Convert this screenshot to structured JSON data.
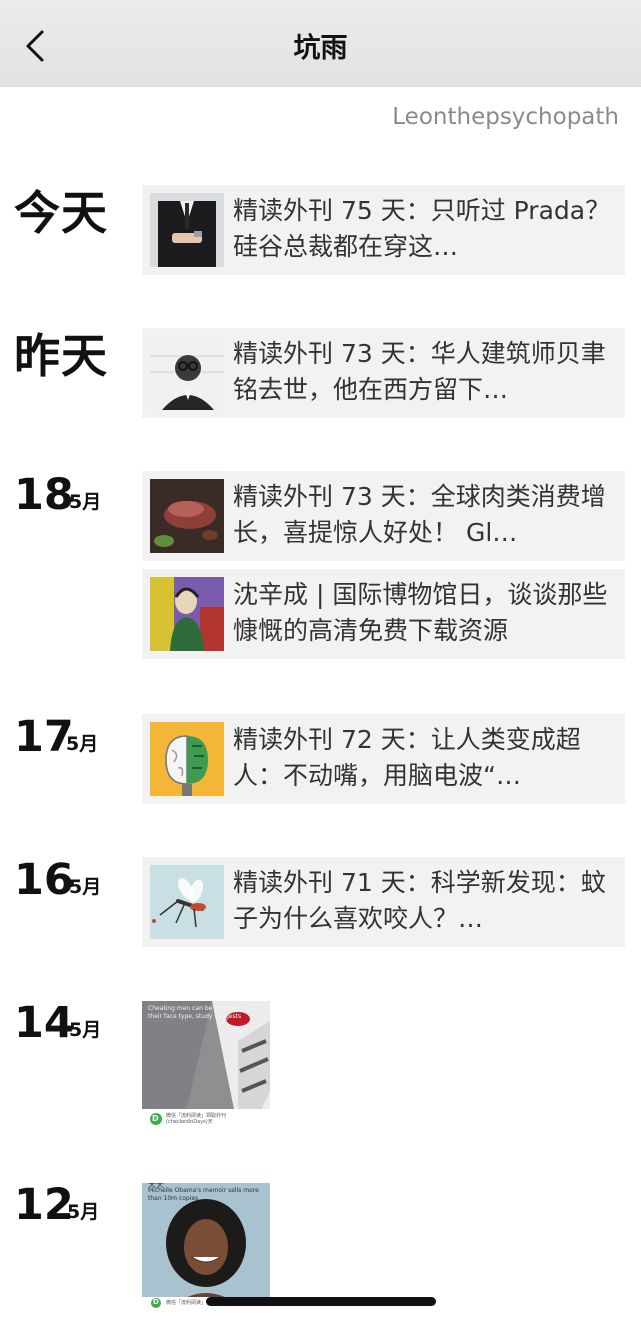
{
  "header": {
    "title": "坑雨",
    "username": "Leonthepsychopath"
  },
  "groups": [
    {
      "day_label": "今天"
    },
    {
      "day_label": "昨天"
    },
    {
      "day": "18",
      "month": "5月"
    },
    {
      "day": "17",
      "month": "5月"
    },
    {
      "day": "16",
      "month": "5月"
    },
    {
      "day": "14",
      "month": "5月"
    },
    {
      "day": "12",
      "month": "5月"
    }
  ],
  "posts": [
    {
      "text": "精读外刊 75 天：只听过 Prada？硅谷总裁都在穿这…"
    },
    {
      "text": "精读外刊 73 天：华人建筑师贝聿铭去世，他在西方留下…"
    },
    {
      "text": "精读外刊 73 天：全球肉类消费增长，喜提惊人好处！ Gl…"
    },
    {
      "text": "沈辛成 | 国际博物馆日，谈谈那些慷慨的高清免费下载资源"
    },
    {
      "text": "精读外刊 72 天：让人类变成超人：不动嘴，用脑电波“…"
    },
    {
      "text": "精读外刊 71 天：科学新发现：蚊子为什么喜欢咬人？…"
    }
  ],
  "image_posts": [
    {
      "caption": "Cheating men can be spotted by their face type, study suggests",
      "footer": "微信「流利阅读」领取外刊 (checkedInDays)天",
      "badge": "D"
    },
    {
      "caption": "Michelle Obama's memoir sells more than 10m copies",
      "footer": "微信「流利阅读」领取外刊",
      "badge": "D",
      "top_text": "天天"
    }
  ],
  "colors": {
    "header_bg": "#e6e6e6",
    "card_bg": "#f2f2f2",
    "username": "#8a8a8a"
  }
}
